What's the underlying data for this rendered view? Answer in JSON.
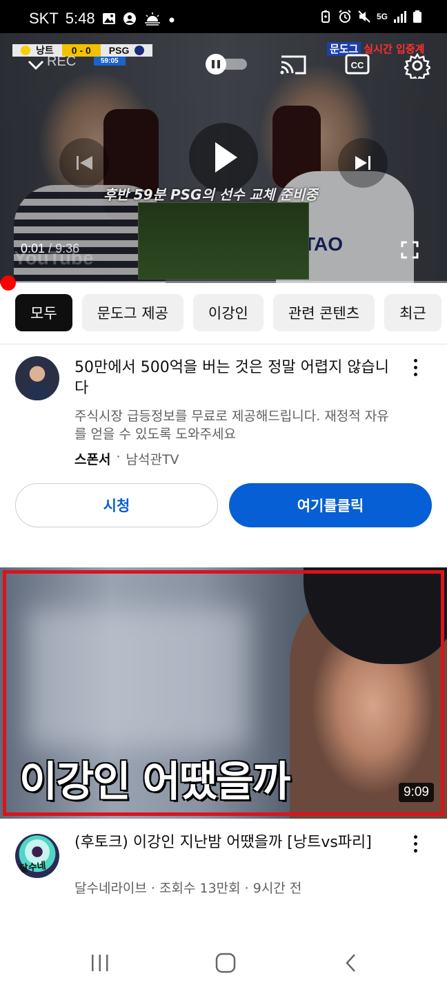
{
  "status_bar": {
    "carrier": "SKT",
    "time": "5:48",
    "network": "5G",
    "icons_left": [
      "gallery-icon",
      "account-icon",
      "sunrise-icon",
      "dot-icon"
    ],
    "icons_right": [
      "battery-saver-icon",
      "alarm-icon",
      "mute-icon",
      "signal-icon",
      "battery-icon"
    ]
  },
  "player": {
    "scoreboard": {
      "home": "낭트",
      "score": "0 - 0",
      "away": "PSG",
      "match_time": "59:05"
    },
    "rec_label": "REC",
    "brand_badge_1": "문도그",
    "brand_badge_2": "실시간 입중계",
    "caption": "후반 59분 PSG의 선수 교체 준비중",
    "shirt_text": "TAO",
    "watermark": "YouTube",
    "current_time": "0:01",
    "separator": " / ",
    "duration": "9:36",
    "progress_fraction": 0.002,
    "accent": "#ff0000"
  },
  "chips": [
    {
      "label": "모두",
      "active": true
    },
    {
      "label": "문도그 제공",
      "active": false
    },
    {
      "label": "이강인",
      "active": false
    },
    {
      "label": "관련 콘텐츠",
      "active": false
    },
    {
      "label": "최근",
      "active": false
    }
  ],
  "ad": {
    "title": "50만에서 500억을 버는 것은 정말 어렵지 않습니다",
    "description": "주식시장 급등정보를 무료로 제공해드립니다. 재정적 자유를 얻을 수 있도록 도와주세요",
    "sponsor_label": "스폰서",
    "dot": "·",
    "advertiser": "남석관TV",
    "watch_button": "시청",
    "cta_button": "여기를클릭",
    "cta_color": "#065fd4"
  },
  "video": {
    "thumbnail_text": "이강인 어땠을까",
    "duration": "9:09",
    "title": "(후토크) 이강인 지난밤 어땠을까 [낭트vs파리]",
    "channel_logo_text": "달수네",
    "meta": "달수네라이브 · 조회수 13만회 · 9시간 전",
    "frame_color": "#d8141d"
  },
  "nav_bar": {
    "buttons": [
      "recent-apps-icon",
      "home-icon",
      "back-icon"
    ]
  }
}
